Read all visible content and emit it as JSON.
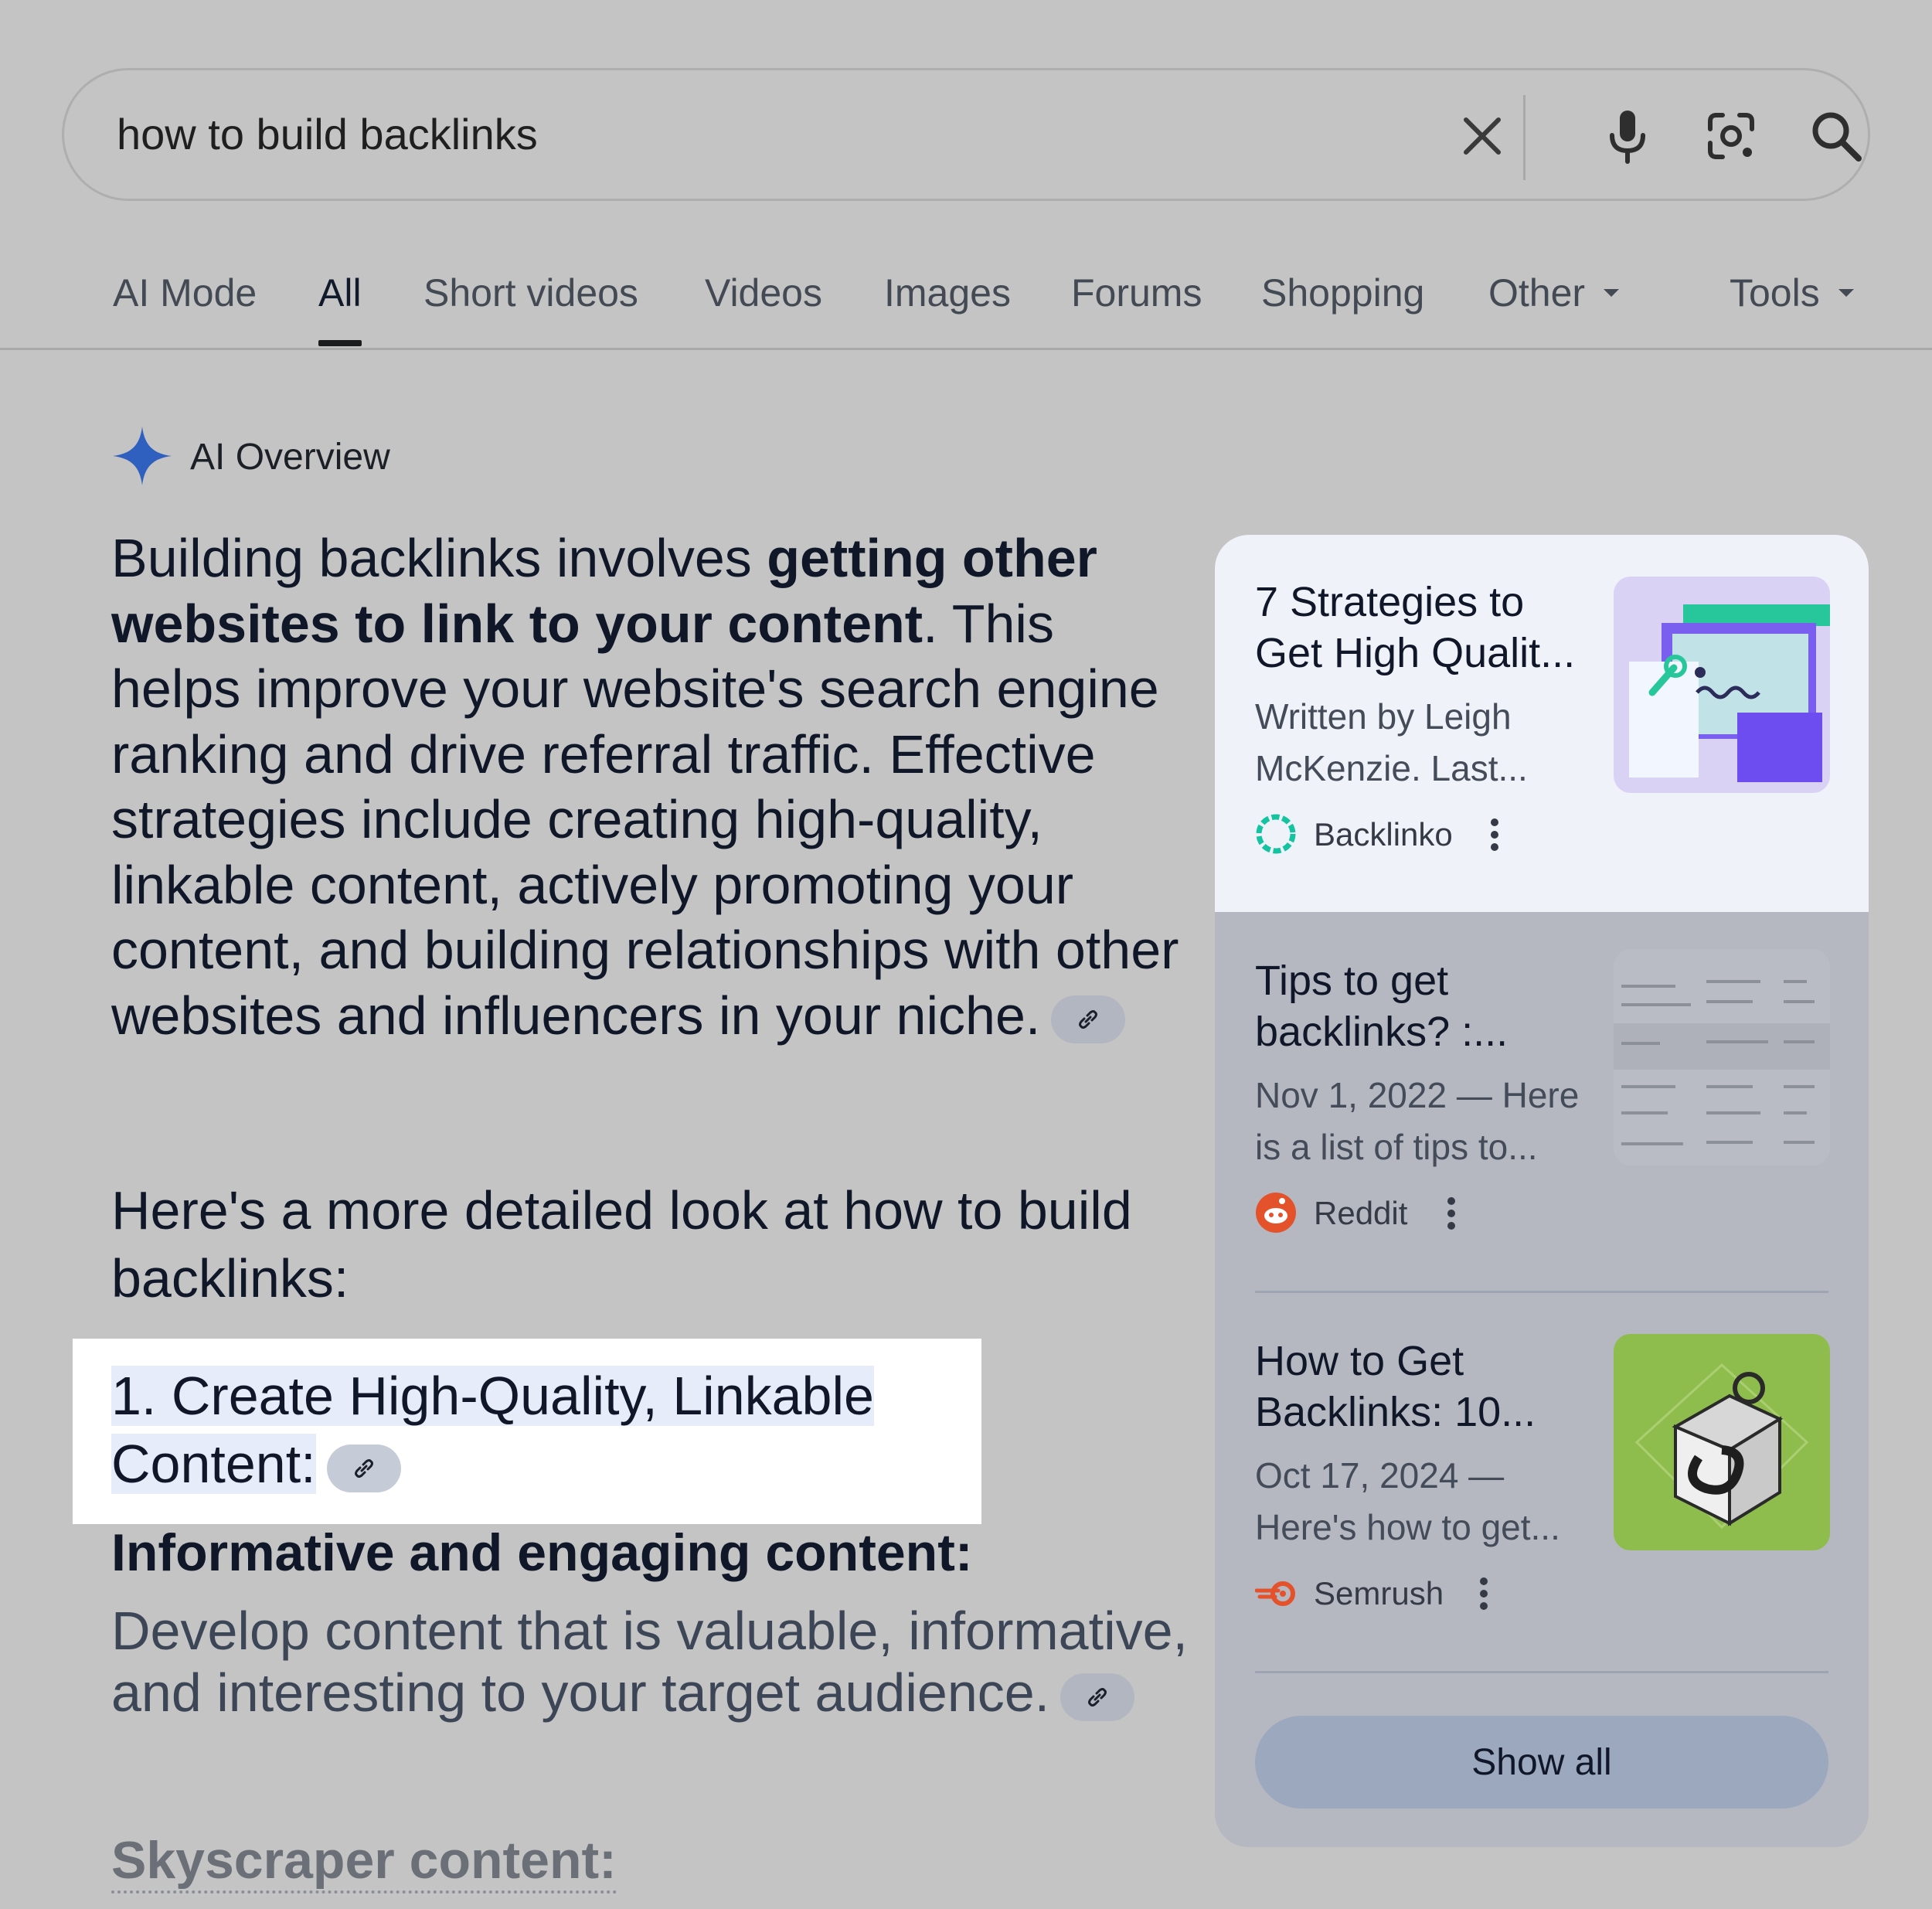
{
  "search": {
    "query": "how to build backlinks"
  },
  "tabs": [
    {
      "label": "AI Mode"
    },
    {
      "label": "All"
    },
    {
      "label": "Short videos"
    },
    {
      "label": "Videos"
    },
    {
      "label": "Images"
    },
    {
      "label": "Forums"
    },
    {
      "label": "Shopping"
    },
    {
      "label": "Other"
    },
    {
      "label": "Tools"
    }
  ],
  "ai_overview": {
    "title": "AI Overview",
    "intro_plain_1": "Building backlinks involves ",
    "intro_bold": "getting other websites to link to your content",
    "intro_plain_2": ". This helps improve your website's search engine ranking and drive referral traffic. Effective strategies include creating high-quality, linkable content, actively promoting your content, and building relationships with other websites and influencers in your niche.",
    "detail_intro": "Here's a more detailed look at how to build backlinks:",
    "step_1_title": "1. Create High-Quality, Linkable Content:",
    "sub_heading_1": "Informative and engaging content:",
    "sub_body_1": "Develop content that is valuable, informative, and interesting to your target audience.",
    "sub_heading_2": "Skyscraper content:"
  },
  "sources": [
    {
      "title": "7 Strategies to Get High Qualit...",
      "snippet": "Written by Leigh McKenzie. Last...",
      "site": "Backlinko",
      "logo_color": "#14c4a0"
    },
    {
      "title": "Tips to get backlinks? :...",
      "snippet": "Nov 1, 2022 — Here is a list of tips to...",
      "site": "Reddit",
      "logo_color": "#e4522b"
    },
    {
      "title": "How to Get Backlinks: 10...",
      "snippet": "Oct 17, 2024 — Here's how to get...",
      "site": "Semrush",
      "logo_color": "#e4522b"
    }
  ],
  "show_all_label": "Show all",
  "colors": {
    "background": "#c4c4c4",
    "ai_spark": "#2f5fbf",
    "highlight": "#ffffff",
    "panel": "#b5b8c1",
    "show_all": "#9ca8bd"
  }
}
